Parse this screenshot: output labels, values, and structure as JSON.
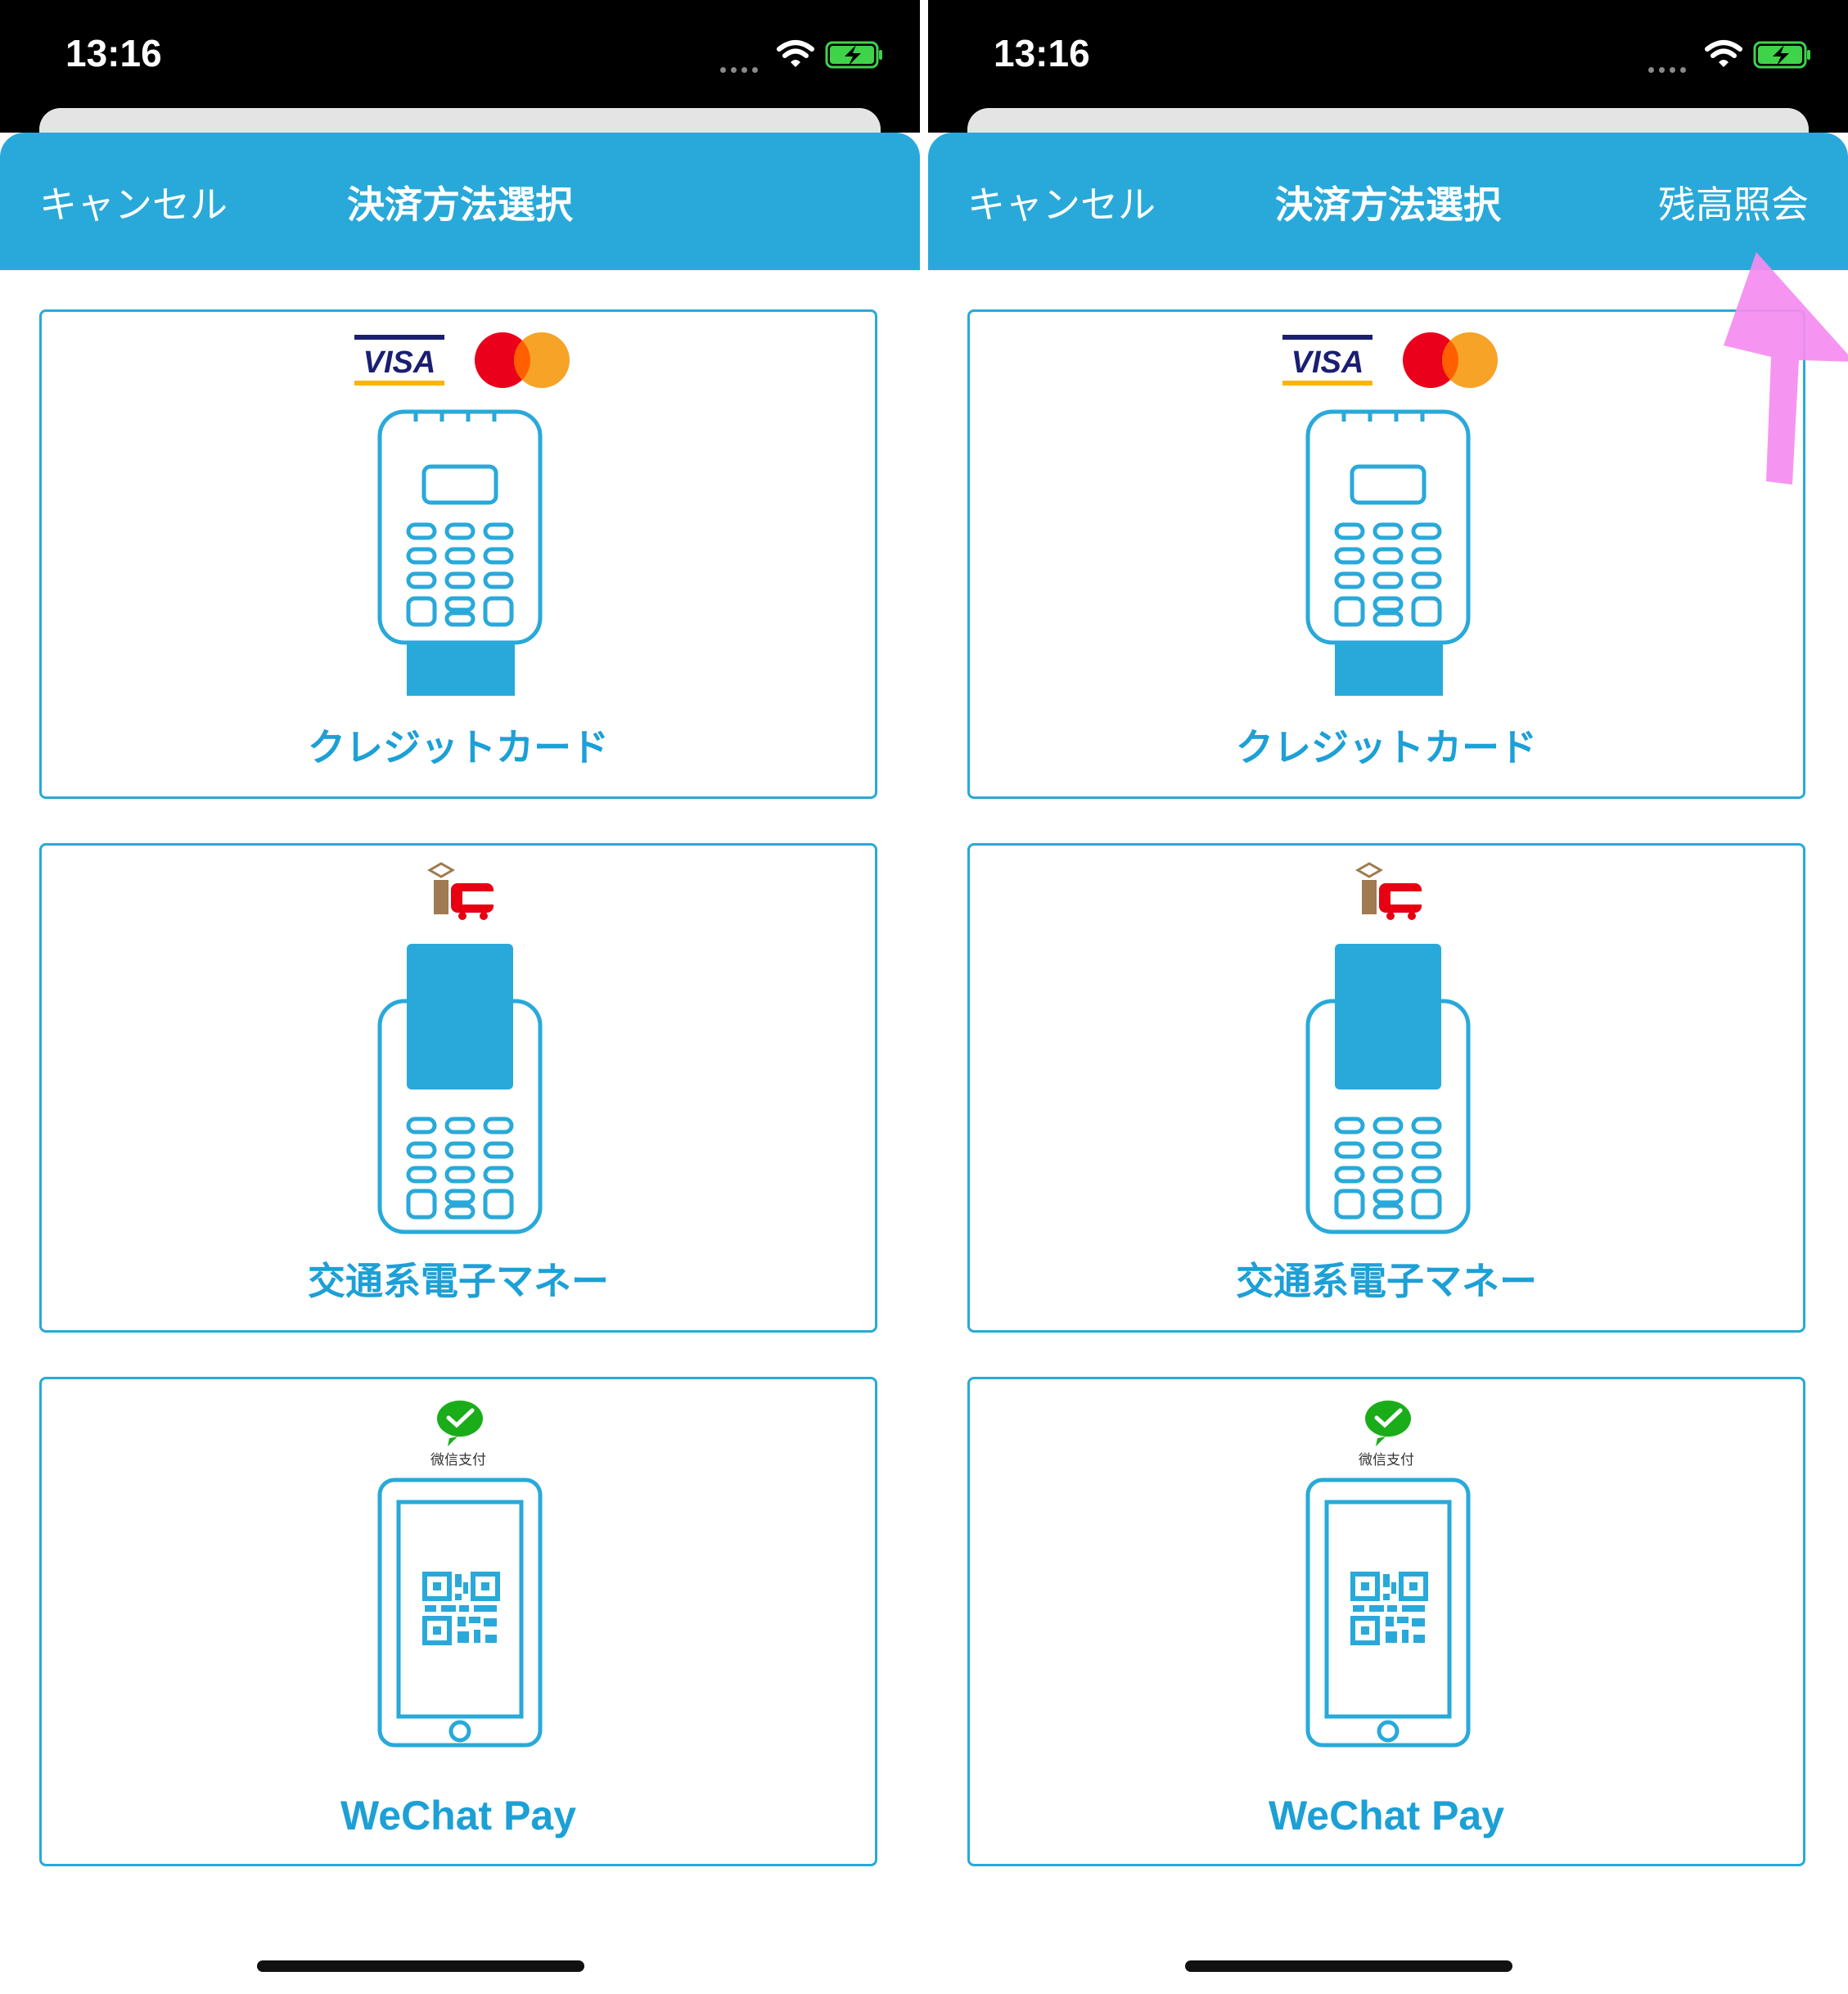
{
  "status_bar": {
    "time": "13:16"
  },
  "nav": {
    "cancel": "キャンセル",
    "title": "決済方法選択",
    "balance_inquiry": "残高照会"
  },
  "payment_methods": [
    {
      "label": "クレジットカード",
      "logos": [
        "VISA",
        "Mastercard"
      ]
    },
    {
      "label": "交通系電子マネー",
      "logos": [
        "IC"
      ]
    },
    {
      "label": "WeChat Pay",
      "logos": [
        "微信支付"
      ]
    }
  ],
  "brand": {
    "visa_text": "VISA",
    "ic_text": "IC",
    "wechat_logo_text": "微信支付"
  },
  "colors": {
    "nav_bg": "#29a9d9",
    "accent": "#1ca0d6",
    "annotation_arrow": "#f58cf0"
  }
}
